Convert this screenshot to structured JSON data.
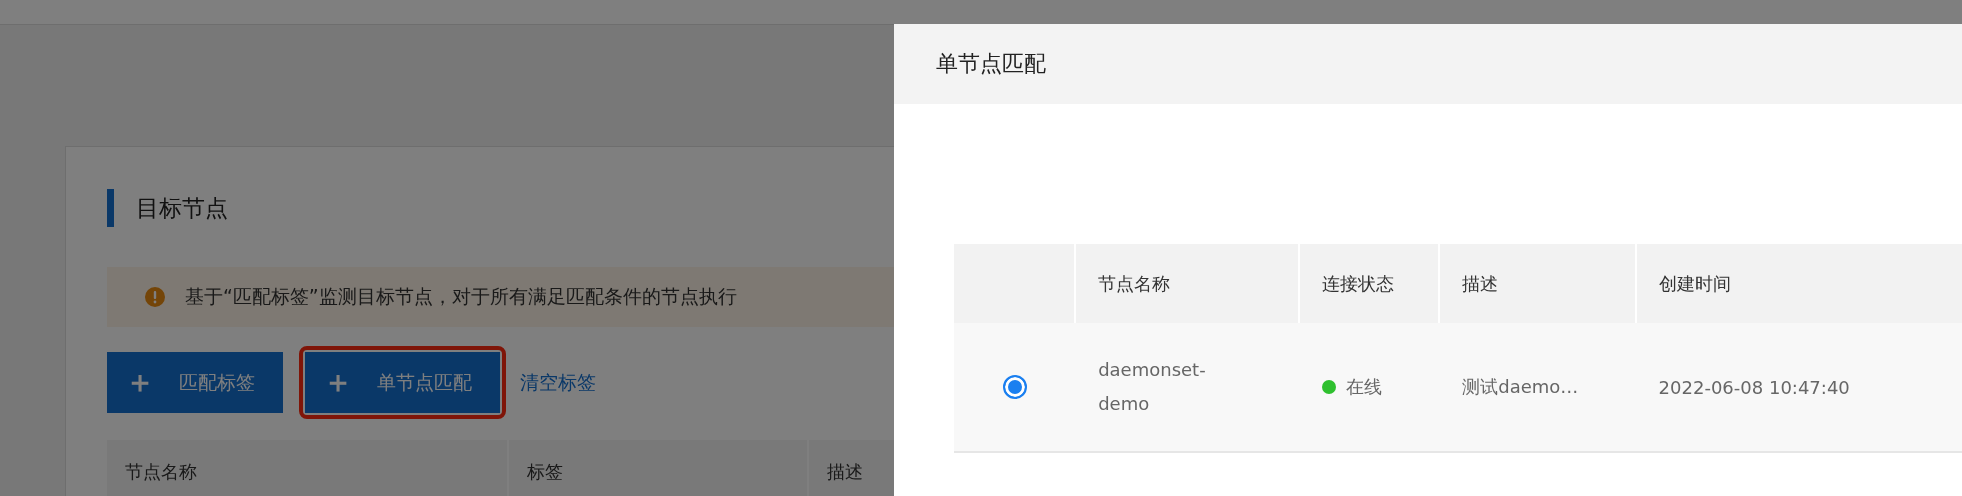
{
  "page": {
    "section_title": "目标节点",
    "alert": "基于“匹配标签”监测目标节点，对于所有满足匹配条件的节点执行",
    "buttons": [
      {
        "label": "匹配标签",
        "icon": "＋",
        "highlighted": false
      },
      {
        "label": "单节点匹配",
        "icon": "＋",
        "highlighted": true
      }
    ],
    "link": "清空标签",
    "table": {
      "columns": [
        "节点名称",
        "标签",
        "描述"
      ]
    }
  },
  "drawer": {
    "title": "单节点匹配",
    "table": {
      "columns": [
        "节点名称",
        "连接状态",
        "描述",
        "创建时间"
      ],
      "rows": [
        {
          "selected": true,
          "name": "daemonset-demo",
          "status": "在线",
          "color": "#2fc02f",
          "description": "测试daemo…",
          "created": "2022-06-08 10:47:40"
        }
      ]
    }
  }
}
